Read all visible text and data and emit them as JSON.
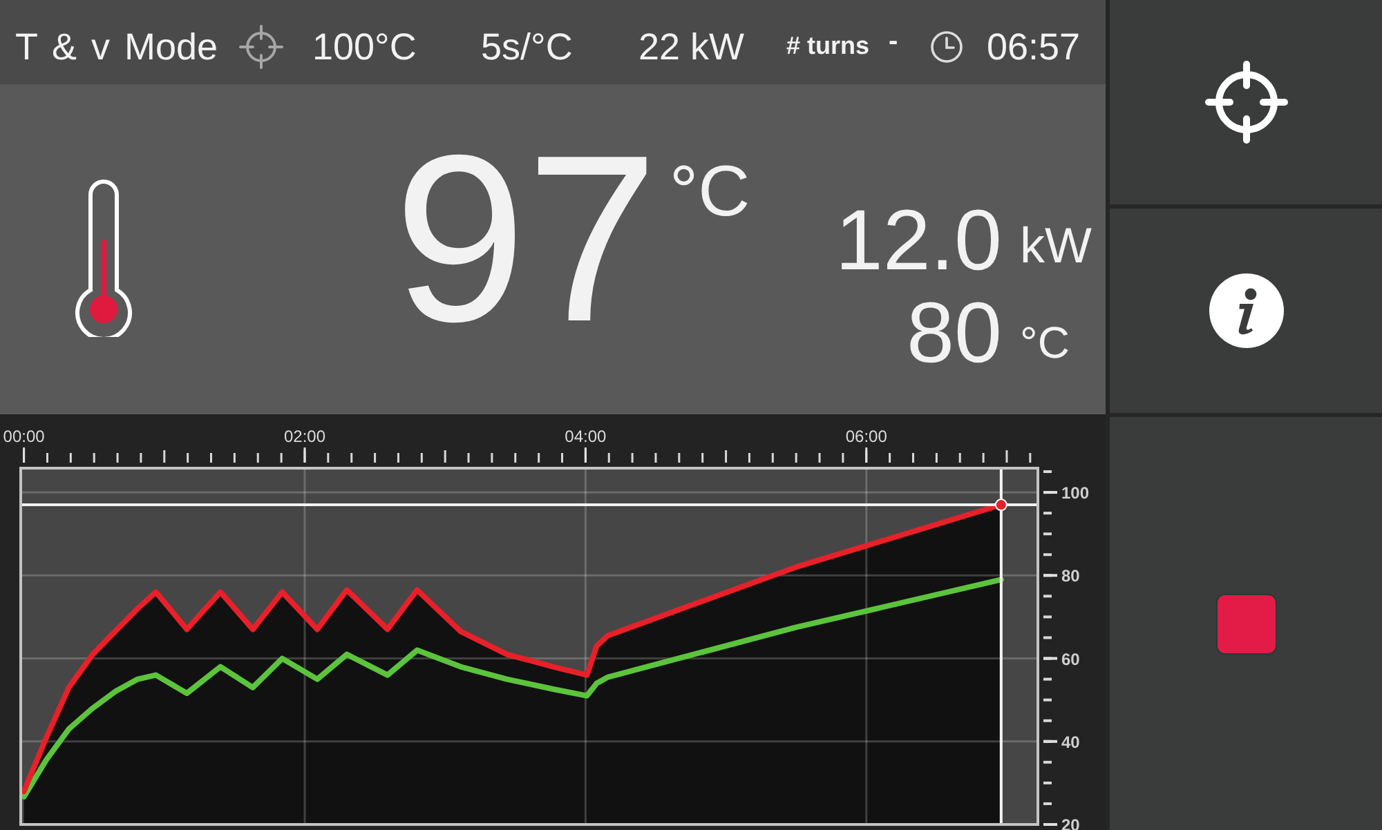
{
  "top_bar": {
    "mode": "T & v Mode",
    "target_temperature": "100°C",
    "rate": "5s/°C",
    "power_limit": "22 kW",
    "turns_label": "# turns",
    "turns_value": "-",
    "elapsed_time": "06:57"
  },
  "readout": {
    "temperature": "97",
    "temperature_unit": "°C",
    "power": "12.0",
    "power_unit": "kW",
    "secondary_temperature": "80",
    "secondary_temperature_unit": "°C"
  },
  "chart": {
    "chart_data": {
      "type": "area",
      "x": [
        0,
        0.16,
        0.32,
        0.49,
        0.65,
        0.81,
        0.94,
        1.16,
        1.4,
        1.63,
        1.84,
        2.09,
        2.3,
        2.59,
        2.8,
        3.11,
        3.44,
        3.77,
        4.01,
        4.08,
        4.16,
        5.5,
        6.96
      ],
      "series": [
        {
          "color": "#e8202a",
          "values": [
            28,
            41,
            53,
            61,
            66.5,
            72,
            76,
            67,
            76,
            67,
            76,
            67,
            76.5,
            67,
            76.5,
            66.5,
            61,
            58,
            56,
            63,
            65.5,
            82,
            97
          ]
        },
        {
          "type": "line",
          "color": "#5cc43c",
          "values": [
            26.7,
            35.6,
            43,
            48,
            52,
            55,
            56,
            51.6,
            58,
            53,
            60,
            55,
            61,
            56,
            62,
            58,
            55,
            52.6,
            51,
            54,
            55.5,
            67.5,
            79
          ]
        }
      ],
      "xlim": [
        0,
        7.2
      ],
      "ylim": [
        20,
        105.5
      ],
      "xticks": [
        {
          "value": 0,
          "label": "00:00"
        },
        {
          "value": 2,
          "label": "02:00"
        },
        {
          "value": 4,
          "label": "04:00"
        },
        {
          "value": 6,
          "label": "06:00"
        }
      ],
      "yticks": [
        20,
        40,
        60,
        80,
        100
      ],
      "grid": true,
      "ref_lines": [
        {
          "axis": "x",
          "value": 6.96
        },
        {
          "axis": "y",
          "value": 97
        }
      ]
    }
  },
  "side_buttons": [
    {
      "kind": "crosshair"
    },
    {
      "kind": "info"
    },
    {
      "kind": "stop"
    }
  ]
}
